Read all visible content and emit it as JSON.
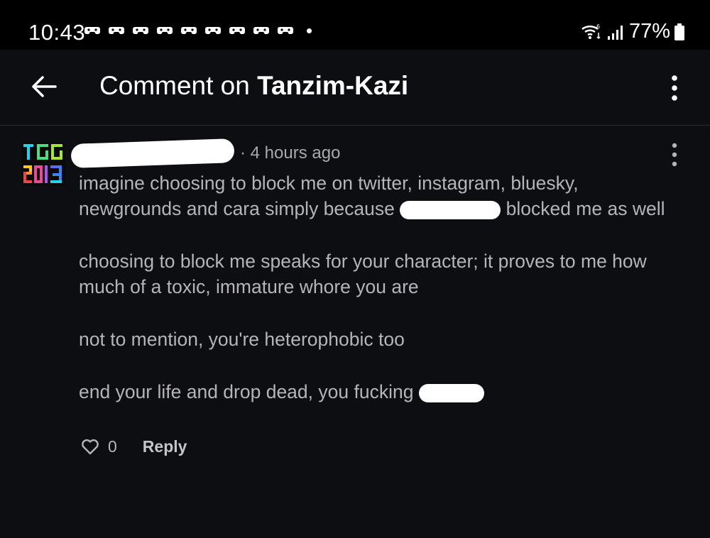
{
  "status_bar": {
    "time": "10:43",
    "battery": "77%",
    "notification_icons": [
      "game-icon",
      "game-icon",
      "game-icon",
      "game-icon",
      "game-icon",
      "game-icon",
      "game-icon",
      "game-icon",
      "game-icon"
    ]
  },
  "header": {
    "title_prefix": "Comment on ",
    "title_user": "Tanzim-Kazi"
  },
  "comment": {
    "timestamp": "· 4 hours ago",
    "paragraphs": {
      "p1_part1": "imagine choosing to block me on twitter, instagram, bluesky, newgrounds and cara simply because ",
      "p1_part2": " blocked me as well",
      "p2": "choosing to block me speaks for your character; it proves to me how much of a toxic, immature whore you are",
      "p3": "not to mention, you're heterophobic too",
      "p4": "end your life and drop dead, you fucking "
    },
    "likes": "0",
    "reply_label": "Reply"
  },
  "colors": {
    "background": "#0d0e12",
    "status_bar": "#000000",
    "text": "#b4b4ba",
    "title": "#ffffff"
  }
}
